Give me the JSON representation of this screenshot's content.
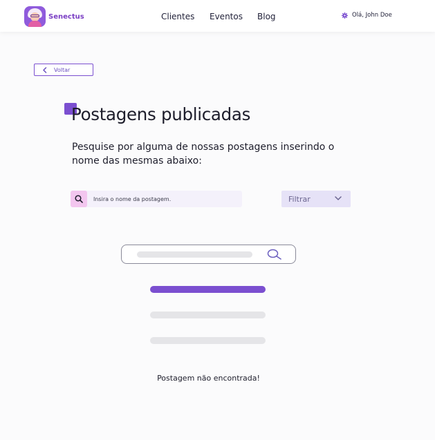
{
  "brand": {
    "name": "Senectus",
    "name_accent": "•"
  },
  "nav": {
    "items": [
      "Clientes",
      "Eventos",
      "Blog"
    ]
  },
  "user": {
    "greeting": "Olá, John Doe"
  },
  "back": {
    "label": "Voltar"
  },
  "page": {
    "title": "Postagens publicadas",
    "subtitle": "Pesquise por alguma de nossas postagens inserindo o nome das mesmas abaixo:"
  },
  "search": {
    "placeholder": "Insira o nome da postagem.",
    "value": ""
  },
  "filter": {
    "selected": "Filtrar"
  },
  "empty_state": {
    "message": "Postagem não encontrada!"
  },
  "colors": {
    "accent": "#7b4fd0",
    "accent_pink": "#f3c6ef",
    "filter_bg": "#e6e2f7",
    "skeleton_gray": "#e5e5e8",
    "skeleton_active": "#7b4fd0"
  },
  "icons": {
    "user": "gear-icon",
    "back": "chevron-left-icon",
    "search": "search-icon",
    "filter": "chevron-down-icon"
  }
}
